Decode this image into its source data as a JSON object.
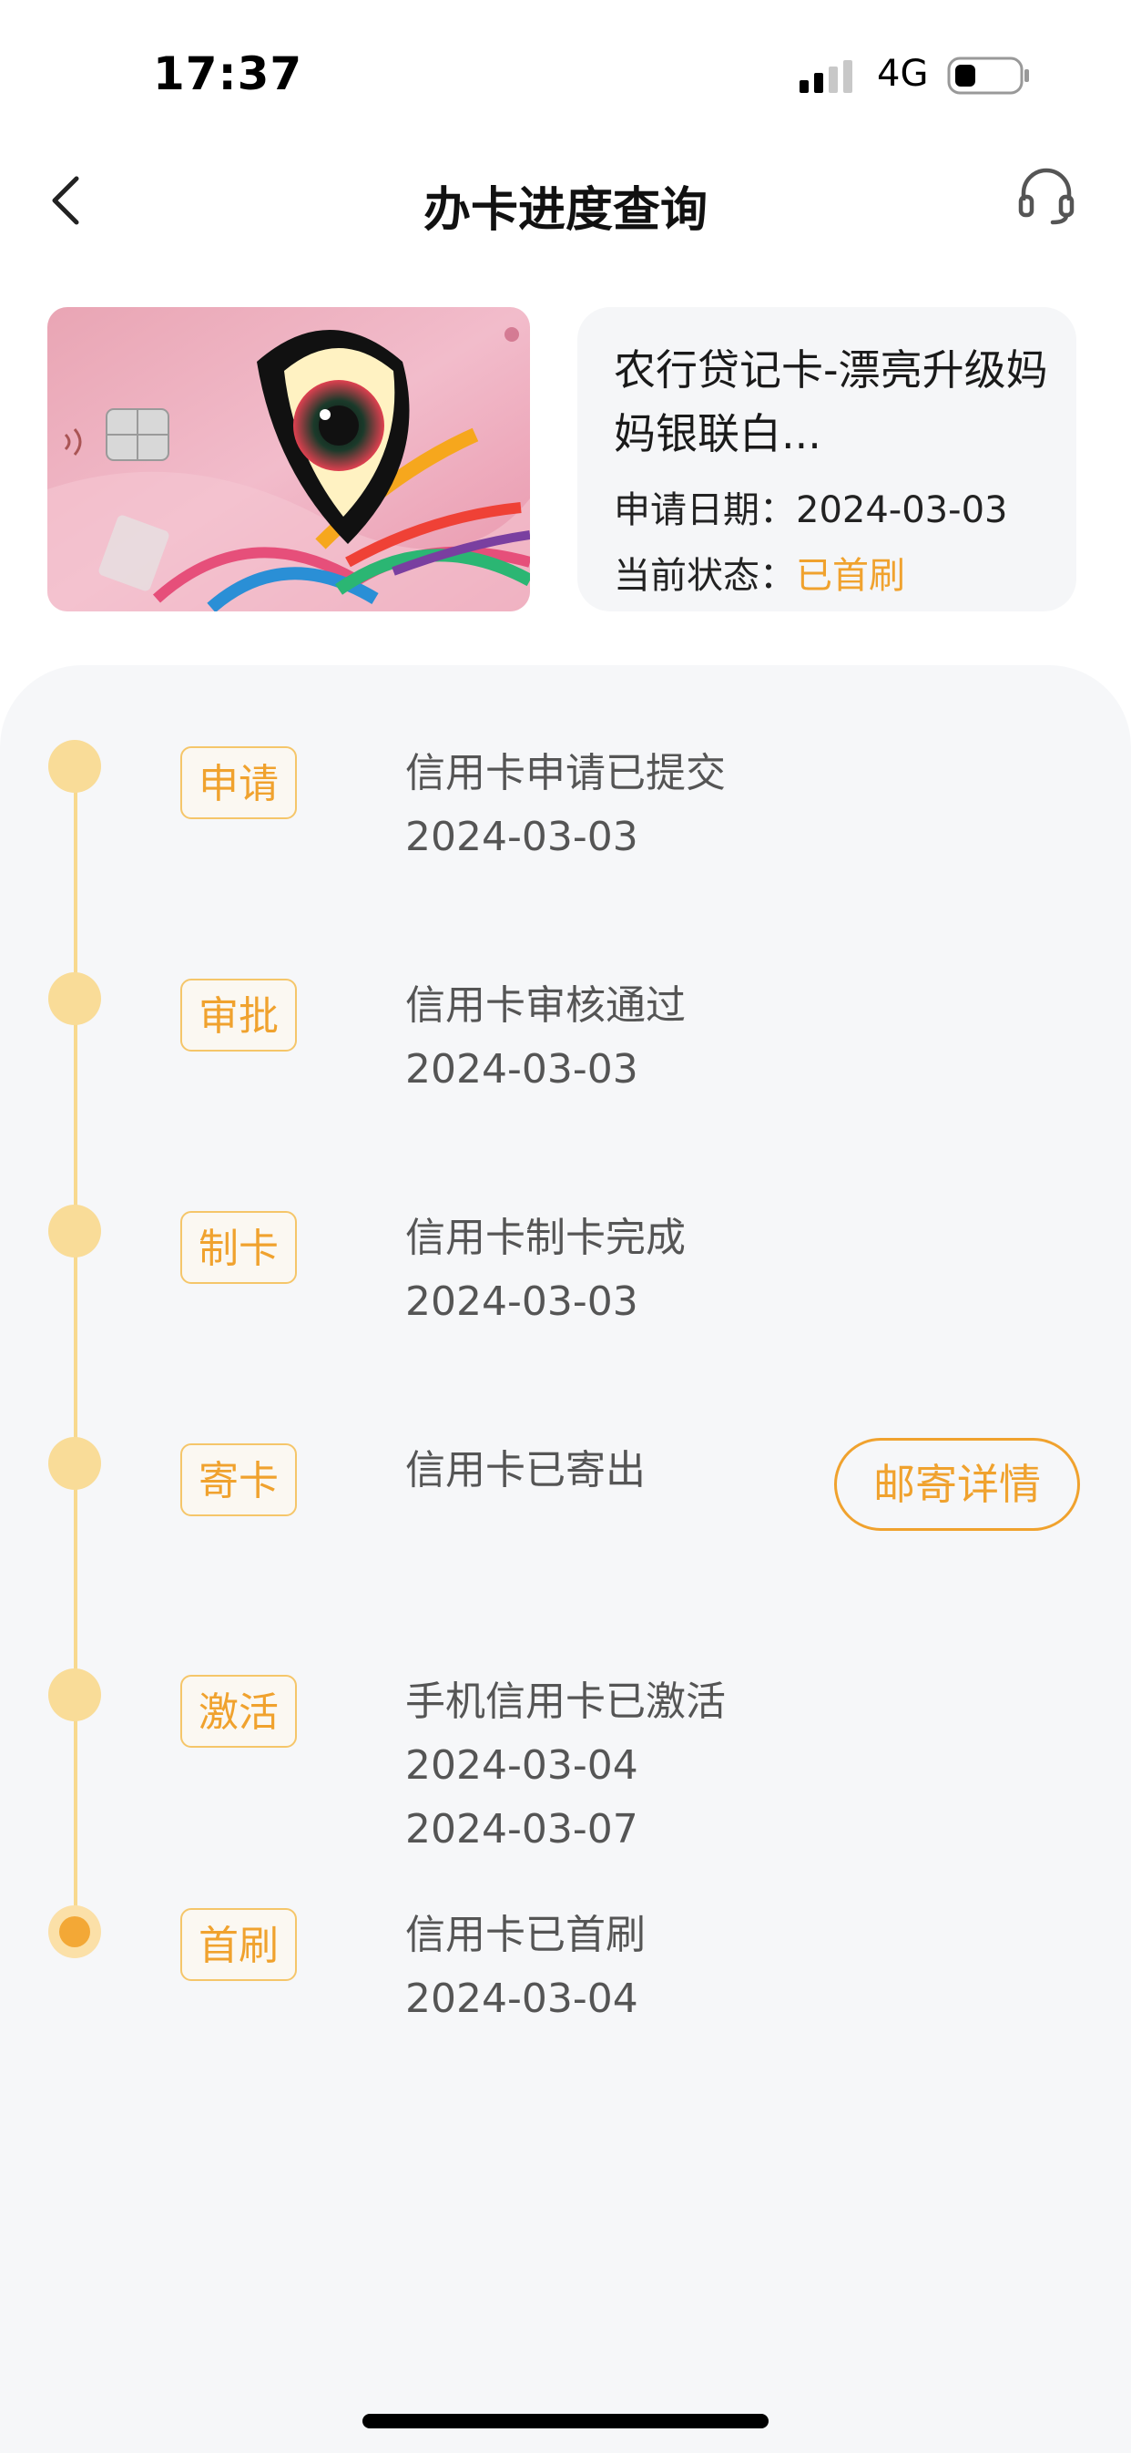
{
  "status_bar": {
    "time": "17:37",
    "network": "4G"
  },
  "nav": {
    "title": "办卡进度查询"
  },
  "card": {
    "name": "农行贷记卡-漂亮升级妈妈银联白...",
    "apply_date_label": "申请日期：",
    "apply_date": "2024-03-03",
    "status_label": "当前状态：",
    "status_value": "已首刷",
    "status_color": "#f0a22e"
  },
  "steps": [
    {
      "tag": "申请",
      "title": "信用卡申请已提交",
      "dates": [
        "2024-03-03"
      ]
    },
    {
      "tag": "审批",
      "title": "信用卡审核通过",
      "dates": [
        "2024-03-03"
      ]
    },
    {
      "tag": "制卡",
      "title": "信用卡制卡完成",
      "dates": [
        "2024-03-03"
      ]
    },
    {
      "tag": "寄卡",
      "title": "信用卡已寄出",
      "dates": [],
      "action": "邮寄详情"
    },
    {
      "tag": "激活",
      "title": "手机信用卡已激活",
      "dates": [
        "2024-03-04",
        "2024-03-07"
      ]
    },
    {
      "tag": "首刷",
      "title": "信用卡已首刷",
      "dates": [
        "2024-03-04"
      ],
      "current": true
    }
  ],
  "colors": {
    "accent": "#f0a22e",
    "timeline": "#f8d98e",
    "panel_bg": "#f6f7f9"
  }
}
